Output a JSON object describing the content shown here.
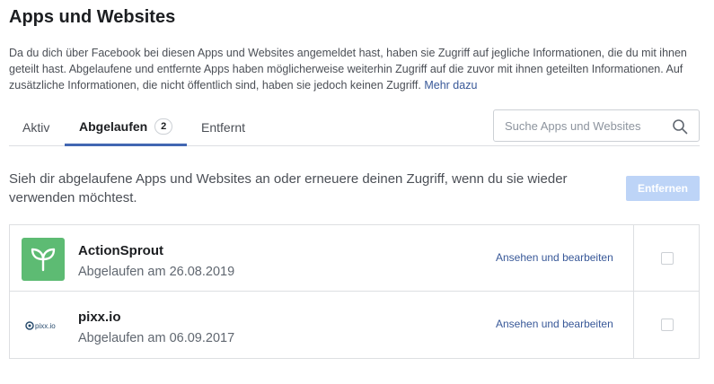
{
  "page": {
    "title": "Apps und Websites",
    "intro": "Da du dich über Facebook bei diesen Apps und Websites angemeldet hast, haben sie Zugriff auf jegliche Informationen, die du mit ihnen geteilt hast. Abgelaufene und entfernte Apps haben möglicherweise weiterhin Zugriff auf die zuvor mit ihnen geteilten Informationen. Auf zusätzliche Informationen, die nicht öffentlich sind, haben sie jedoch keinen Zugriff.",
    "learn_more": "Mehr dazu"
  },
  "tabs": [
    {
      "label": "Aktiv"
    },
    {
      "label": "Abgelaufen",
      "count": "2"
    },
    {
      "label": "Entfernt"
    }
  ],
  "search": {
    "placeholder": "Suche Apps und Websites"
  },
  "description": "Sieh dir abgelaufene Apps und Websites an oder erneuere deinen Zugriff, wenn du sie wieder verwenden möchtest.",
  "remove_button": "Entfernen",
  "apps": [
    {
      "name": "ActionSprout",
      "status": "Abgelaufen am 26.08.2019",
      "action": "Ansehen und bearbeiten",
      "icon": "actionsprout-logo",
      "icon_color": "#5dbb73"
    },
    {
      "name": "pixx.io",
      "status": "Abgelaufen am 06.09.2017",
      "action": "Ansehen und bearbeiten",
      "icon": "pixxio-logo",
      "logo_text": "pixx.io",
      "icon_color": "#2a4d6e"
    }
  ],
  "colors": {
    "accent": "#4267b2",
    "link": "#385898",
    "disabled_button": "#bdd4f7"
  }
}
